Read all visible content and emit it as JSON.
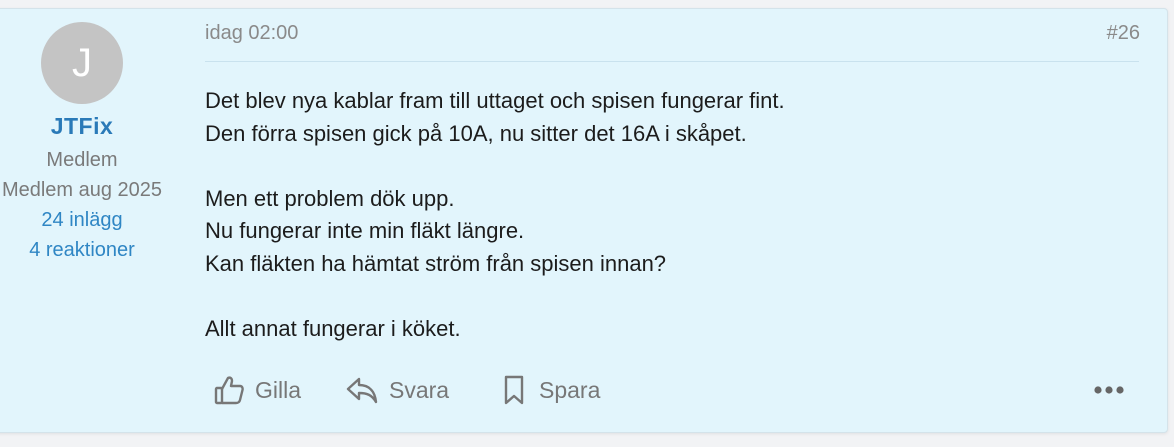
{
  "user": {
    "avatar_letter": "J",
    "name": "JTFix",
    "role": "Medlem",
    "member_since": "Medlem aug 2025",
    "posts": "24 inlägg",
    "reactions": "4 reaktioner"
  },
  "post": {
    "date": "idag 02:00",
    "number": "#26",
    "lines": [
      "Det blev nya kablar fram till uttaget och spisen fungerar fint.",
      "Den förra spisen gick på 10A, nu sitter det 16A i skåpet.",
      "",
      "Men ett problem dök upp.",
      "Nu fungerar inte min fläkt längre.",
      "Kan fläkten ha hämtat ström från spisen innan?",
      "",
      "Allt annat fungerar i köket."
    ]
  },
  "actions": {
    "like": "Gilla",
    "reply": "Svara",
    "save": "Spara"
  },
  "icons": {
    "like": "thumbs-up-icon",
    "reply": "reply-icon",
    "save": "bookmark-icon",
    "more": "more-dots-icon"
  },
  "colors": {
    "post_bg": "#e2f5fc",
    "username": "#2a7ab8",
    "link": "#2f86c4",
    "avatar": "#c4c4c4"
  }
}
